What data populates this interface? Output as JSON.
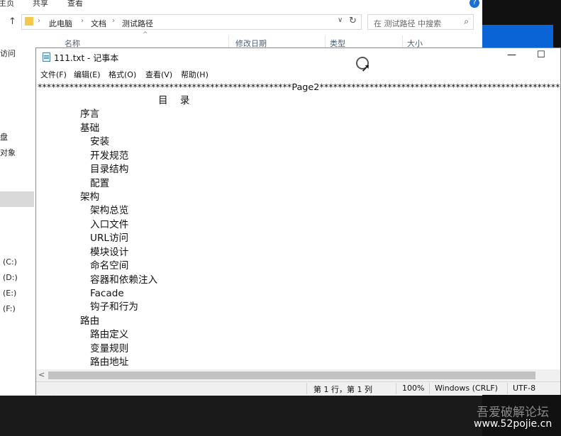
{
  "explorer": {
    "ribbon_tabs": [
      "主页",
      "共享",
      "查看"
    ],
    "help_glyph": "?",
    "breadcrumb": [
      "此电脑",
      "文档",
      "测试路径"
    ],
    "search_placeholder": "在 测试路径 中搜索",
    "columns": [
      "名称",
      "修改日期",
      "类型",
      "大小"
    ],
    "nav_items": [
      "访问",
      "盘",
      "对象",
      "(C:)",
      "(D:)",
      "(E:)",
      "(F:)"
    ]
  },
  "notepad": {
    "title": "111.txt - 记事本",
    "controls": {
      "minimize": "—",
      "maximize": "☐"
    },
    "menu": [
      "文件(F)",
      "编辑(E)",
      "格式(O)",
      "查看(V)",
      "帮助(H)"
    ],
    "lines": [
      "********************************************************Page2******************************************************",
      "目    录",
      "序言",
      "基础",
      "安装",
      "开发规范",
      "目录结构",
      "配置",
      "架构",
      "架构总览",
      "入口文件",
      "URL访问",
      "模块设计",
      "命名空间",
      "容器和依赖注入",
      "Facade",
      "钩子和行为",
      "路由",
      "路由定义",
      "变量规则",
      "路由地址"
    ],
    "status": {
      "position": "第 1 行，第 1 列",
      "zoom": "100%",
      "line_ending": "Windows (CRLF)",
      "encoding": "UTF-8"
    }
  },
  "watermark": {
    "line1": "吾爱破解论坛",
    "line2": "www.52pojie.cn"
  }
}
